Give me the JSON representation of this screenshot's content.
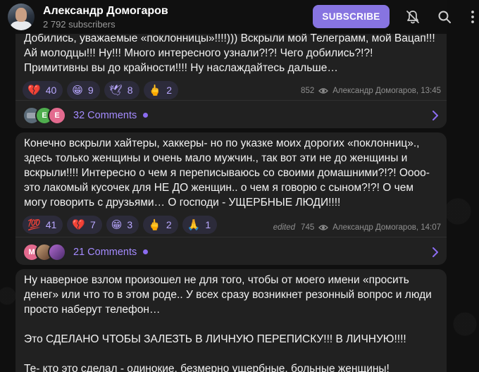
{
  "header": {
    "title": "Александр Домогаров",
    "subtitle": "2 792 subscribers",
    "subscribe_label": "SUBSCRIBE"
  },
  "messages": [
    {
      "text": "Добились, уважаемые «поклонницы»!!!!))) Вскрыли мой Телеграмм, мой Вацап!!! Ай молодцы!!! Ну!!! Много интересного узнали?!?! Чего добились?!?! Примитивны вы до крайности!!!! Ну наслаждайтесь дальше…",
      "reactions": [
        {
          "emoji": "💔",
          "count": "40"
        },
        {
          "emoji": "😁",
          "count": "9"
        },
        {
          "emoji": "🕊",
          "count": "8"
        },
        {
          "emoji": "🖕",
          "count": "2"
        }
      ],
      "views": "852",
      "edited": "",
      "author_time": "Александр Домогаров, 13:45",
      "comments_label": "32 Comments",
      "comment_avatars": [
        {
          "letter": "",
          "color": "#5b6b78"
        },
        {
          "letter": "E",
          "color": "#4fae4e"
        },
        {
          "letter": "E",
          "color": "#e36a8e"
        }
      ]
    },
    {
      "text": "Конечно вскрыли хайтеры, хаккеры- но по указке моих дорогих «поклонниц»., здесь только женщины и очень мало мужчин., так вот эти не до женщины и вскрыли!!!! Интересно о чем я переписываюсь со своими домашними?!?! Оооо- это лакомый кусочек для НЕ ДО женщин.. о чем я говорю с сыном?!?! О чем могу говорить с друзьями… О господи - УЩЕРБНЫЕ ЛЮДИ!!!!",
      "reactions": [
        {
          "emoji": "💯",
          "count": "41"
        },
        {
          "emoji": "💔",
          "count": "7"
        },
        {
          "emoji": "😁",
          "count": "3"
        },
        {
          "emoji": "🖕",
          "count": "2"
        },
        {
          "emoji": "🙏",
          "count": "1"
        }
      ],
      "views": "745",
      "edited": "edited",
      "author_time": "Александр Домогаров, 14:07",
      "comments_label": "21 Comments",
      "comment_avatars": [
        {
          "letter": "M",
          "color": "#e36a8e"
        },
        {
          "letter": "",
          "color": "#7a5a4a"
        },
        {
          "letter": "",
          "color": "#6a4a8a"
        }
      ]
    },
    {
      "text": "Ну наверное взлом произошел не для того, чтобы от моего имени «просить денег» или что то в этом роде.. У всех сразу возникнет резонный вопрос и люди просто наберут телефон…\n\nЭто СДЕЛАНО ЧТОБЫ ЗАЛЕЗТЬ В ЛИЧНУЮ ПЕРЕПИСКУ!!! В ЛИЧНУЮ!!!!\n\nТе- кто это сделал - одинокие, безмерно ущербные, больные женщины!"
    }
  ],
  "colors": {
    "accent": "#8774e1",
    "bubble": "#212121",
    "reaction_bg": "#2c2b3a",
    "reaction_text": "#b9a8ff",
    "link": "#a48bff"
  },
  "icons": {
    "bell": "bell-off-icon",
    "search": "search-icon",
    "more": "more-vertical-icon",
    "views": "eye-icon",
    "comments_arrow": "chevron-right-icon"
  }
}
